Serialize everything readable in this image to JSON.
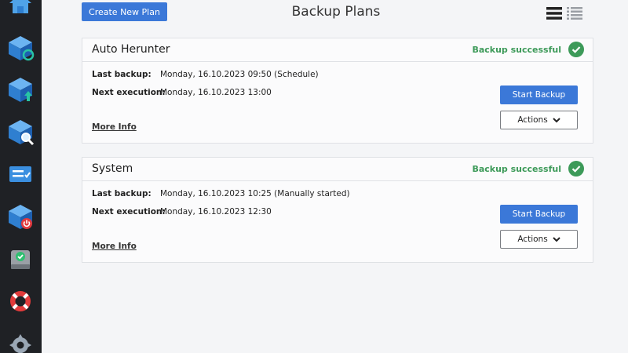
{
  "sidebar": {
    "icons": [
      "home-icon",
      "backup-restore-icon",
      "backup-upload-icon",
      "backup-search-icon",
      "task-list-icon",
      "backup-power-icon",
      "drive-check-icon",
      "lifebuoy-icon",
      "settings-gear-icon"
    ]
  },
  "header": {
    "create_label": "Create New Plan",
    "title": "Backup Plans",
    "view_icons": [
      "list-view-icon",
      "detail-list-view-icon"
    ]
  },
  "labels": {
    "last_backup": "Last backup:",
    "next_execution": "Next execution:",
    "more_info": "More Info",
    "start_backup": "Start Backup",
    "actions": "Actions"
  },
  "plans": [
    {
      "name": "Auto Herunter",
      "status": "Backup successful",
      "last_backup": "Monday, 16.10.2023 09:50 (Schedule)",
      "next_execution": "Monday, 16.10.2023 13:00"
    },
    {
      "name": "System",
      "status": "Backup successful",
      "last_backup": "Monday, 16.10.2023 10:25 (Manually started)",
      "next_execution": "Monday, 16.10.2023 12:30"
    }
  ],
  "colors": {
    "accent": "#3b78d8",
    "success": "#3d9a59",
    "sidebar": "#1f2125"
  }
}
